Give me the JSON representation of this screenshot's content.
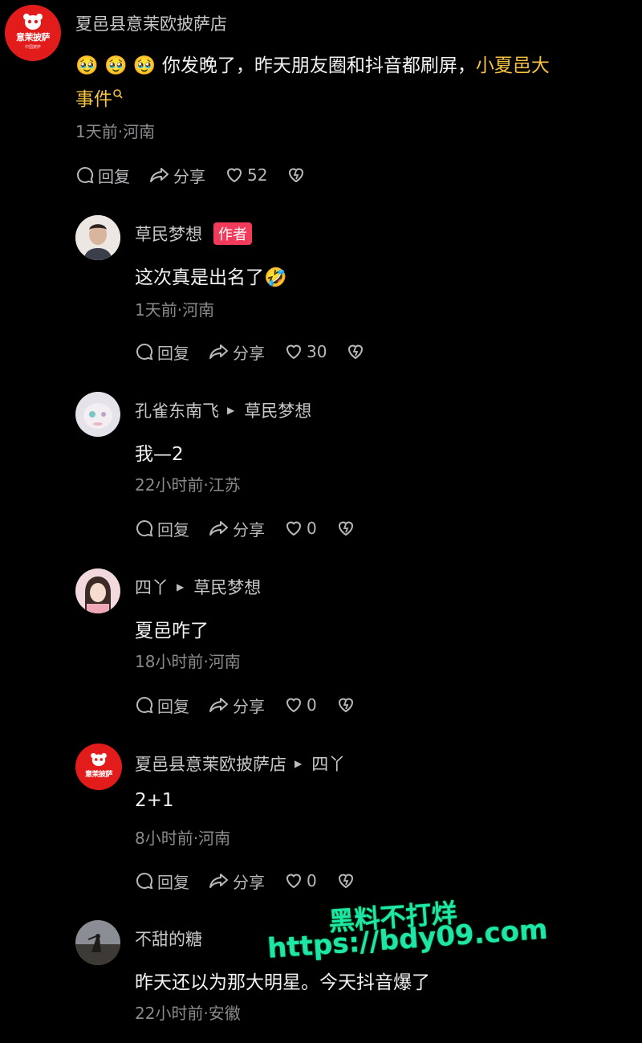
{
  "comments": [
    {
      "author": "夏邑县意茉欧披萨店",
      "emoji": "🥹 🥹 🥹",
      "text_line1": "你发晚了，昨天朋友圈和抖音都刷屏，",
      "link_part1": "小夏邑大",
      "link_part2": "事件",
      "meta": "1天前·河南",
      "reply": "回复",
      "share": "分享",
      "likes": "52"
    },
    {
      "author": "草民梦想",
      "badge": "作者",
      "text": "这次真是出名了",
      "emoji": "🤣",
      "meta": "1天前·河南",
      "reply": "回复",
      "share": "分享",
      "likes": "30"
    },
    {
      "author": "孔雀东南飞",
      "reply_to": "草民梦想",
      "text": "我—2",
      "meta": "22小时前·江苏",
      "reply": "回复",
      "share": "分享",
      "likes": "0"
    },
    {
      "author": "四丫",
      "reply_to": "草民梦想",
      "text": "夏邑咋了",
      "meta": "18小时前·河南",
      "reply": "回复",
      "share": "分享",
      "likes": "0"
    },
    {
      "author": "夏邑县意茉欧披萨店",
      "reply_to": "四丫",
      "text": "2+1",
      "meta": "8小时前·河南",
      "reply": "回复",
      "share": "分享",
      "likes": "0"
    },
    {
      "author": "不甜的糖",
      "text": "昨天还以为那大明星。今天抖音爆了",
      "meta": "22小时前·安徽"
    }
  ],
  "shop_avatar": {
    "brand": "意茉披萨",
    "sub": "中国披萨"
  },
  "watermark": {
    "line1": "黑料不打烊",
    "line2": "https://bdy09.com"
  },
  "colors": {
    "highlight": "#f5c242",
    "badge": "#f23a5a",
    "watermark": "#1ee6a8"
  }
}
